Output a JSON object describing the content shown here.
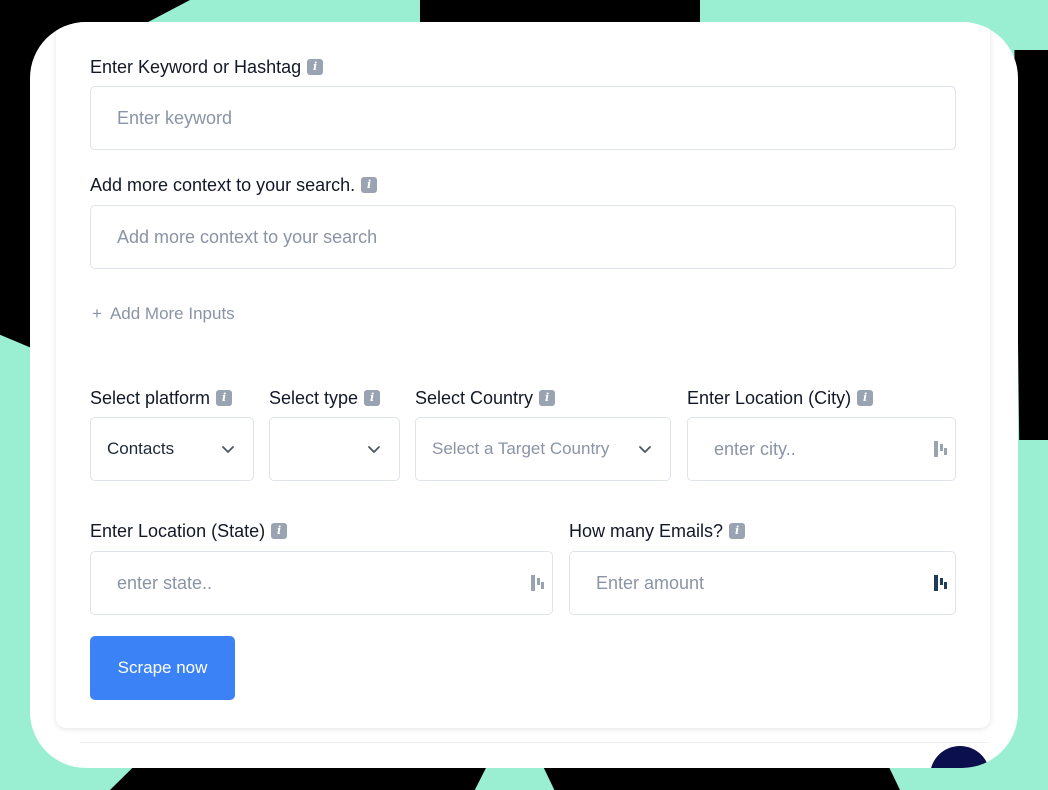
{
  "form": {
    "keyword": {
      "label": "Enter Keyword or Hashtag",
      "placeholder": "Enter keyword"
    },
    "context": {
      "label": "Add more context to your search.",
      "placeholder": "Add more context to your search"
    },
    "add_more": {
      "icon": "+",
      "label": "Add More Inputs"
    },
    "platform": {
      "label": "Select platform",
      "value": "Contacts"
    },
    "type": {
      "label": "Select type",
      "value": ""
    },
    "country": {
      "label": "Select Country",
      "placeholder": "Select a Target Country"
    },
    "city": {
      "label": "Enter Location (City)",
      "placeholder": "enter city.."
    },
    "state": {
      "label": "Enter Location (State)",
      "placeholder": "enter state.."
    },
    "emails": {
      "label": "How many Emails?",
      "placeholder": "Enter amount"
    },
    "submit_label": "Scrape now",
    "info_glyph": "i"
  },
  "colors": {
    "background": "#9aefd3",
    "accent": "#3b82f6",
    "info_badge": "#9aa3b2"
  }
}
